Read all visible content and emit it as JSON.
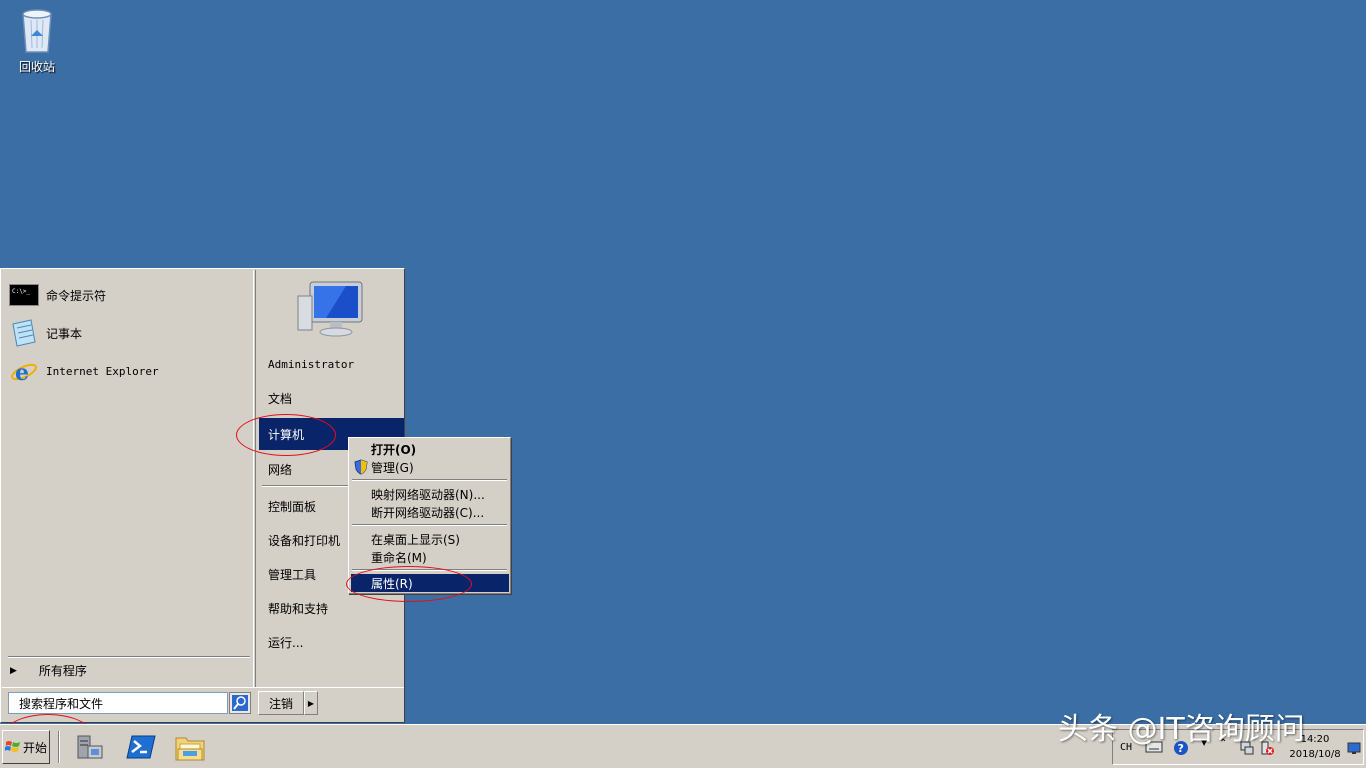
{
  "desktop": {
    "recycle_bin_label": "回收站"
  },
  "start_menu": {
    "programs": [
      {
        "label": "命令提示符",
        "icon": "cmd-icon"
      },
      {
        "label": "记事本",
        "icon": "notepad-icon"
      },
      {
        "label": "Internet Explorer",
        "icon": "ie-icon"
      }
    ],
    "all_programs_label": "所有程序",
    "search_placeholder": "搜索程序和文件",
    "logoff_label": "注销",
    "right": {
      "user": "Administrator",
      "documents": "文档",
      "computer": "计算机",
      "network": "网络",
      "control_panel": "控制面板",
      "devices_printers": "设备和打印机",
      "admin_tools": "管理工具",
      "help": "帮助和支持",
      "run": "运行..."
    }
  },
  "context_menu": {
    "open": "打开(O)",
    "manage": "管理(G)",
    "map_drive": "映射网络驱动器(N)...",
    "disconnect_drive": "断开网络驱动器(C)...",
    "show_on_desktop": "在桌面上显示(S)",
    "rename": "重命名(M)",
    "properties": "属性(R)"
  },
  "taskbar": {
    "start_label": "开始",
    "apps": [
      "server-manager-icon",
      "powershell-icon",
      "explorer-icon"
    ],
    "tray": {
      "lang": "CH",
      "time": "14:20",
      "date": "2018/10/8"
    }
  },
  "watermark": "头条 @IT咨询顾问",
  "colors": {
    "desktop": "#3a6ea5",
    "highlight": "#0a246a",
    "annotation": "#e0101a"
  }
}
